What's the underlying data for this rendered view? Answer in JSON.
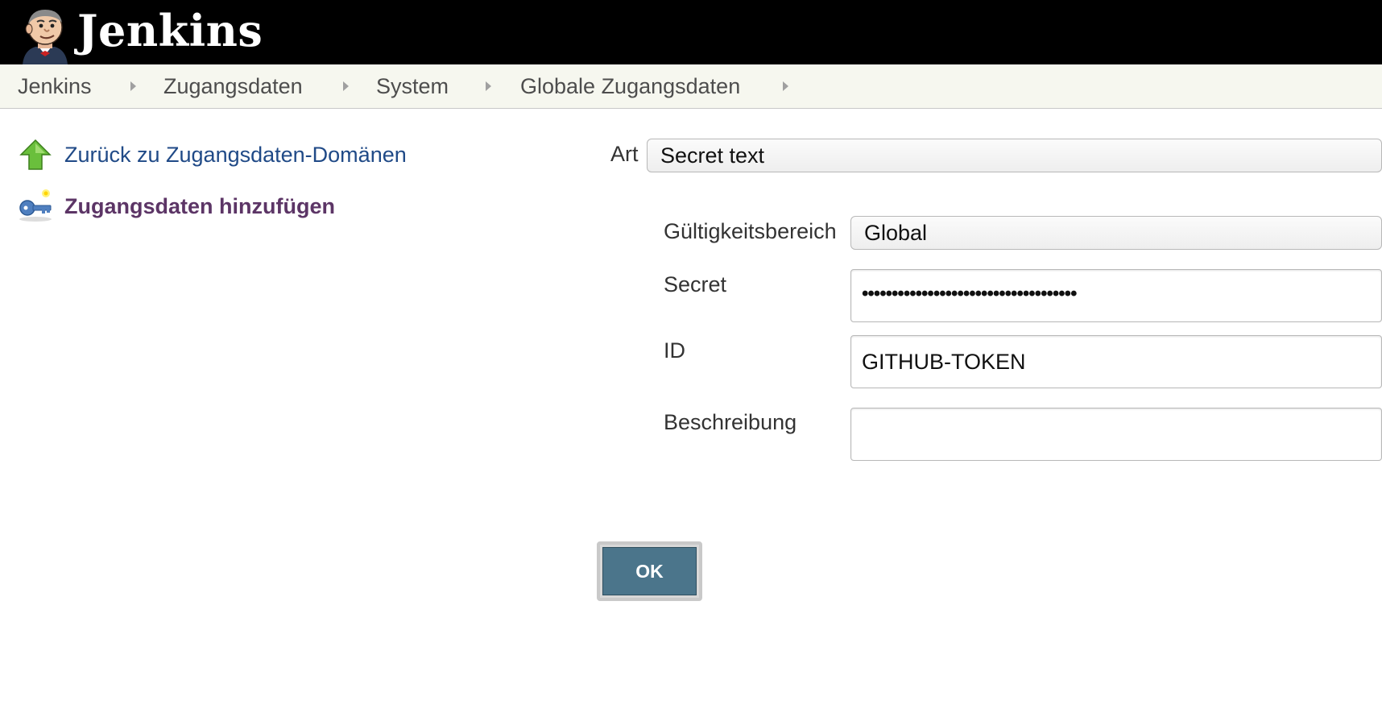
{
  "header": {
    "brand": "Jenkins"
  },
  "breadcrumb": {
    "items": [
      "Jenkins",
      "Zugangsdaten",
      "System",
      "Globale Zugangsdaten"
    ]
  },
  "side_panel": {
    "back_link": "Zurück zu Zugangsdaten-Domänen",
    "add_link": "Zugangsdaten hinzufügen"
  },
  "form": {
    "kind_label": "Art",
    "kind_value": "Secret text",
    "scope_label": "Gültigkeitsbereich",
    "scope_value": "Global",
    "secret_label": "Secret",
    "secret_value": "••••••••••••••••••••••••••••••••••••",
    "id_label": "ID",
    "id_value": "GITHUB-TOKEN",
    "description_label": "Beschreibung",
    "description_value": "",
    "ok_label": "OK"
  },
  "colors": {
    "header_bg": "#000000",
    "breadcrumb_bg": "#f6f7ef",
    "back_link": "#204a87",
    "add_link": "#5c3566",
    "ok_button": "#4b758b"
  }
}
